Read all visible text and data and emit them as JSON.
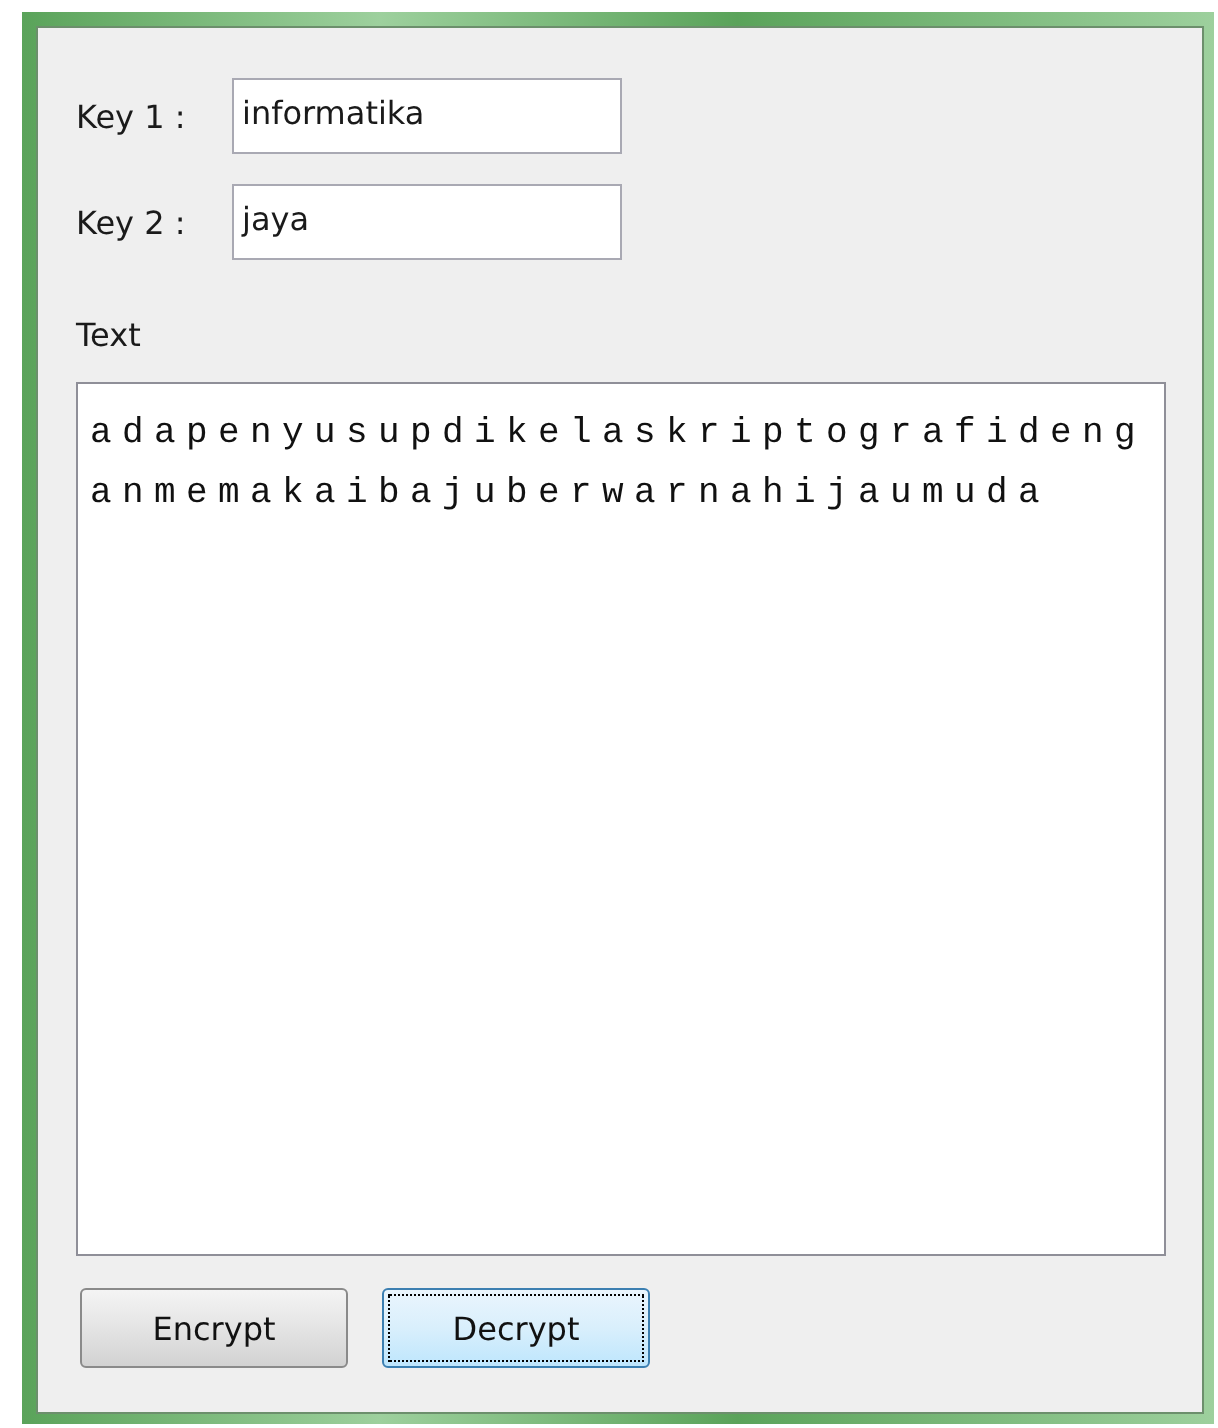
{
  "keys": [
    {
      "label": "Key 1 :",
      "value": "informatika"
    },
    {
      "label": "Key 2 :",
      "value": "jaya"
    }
  ],
  "text": {
    "label": "Text",
    "value": "adapenyusupdikelaskriptografidenganmemakaibajuberwarnahijaumuda"
  },
  "buttons": [
    {
      "label": "Encrypt",
      "focused": false
    },
    {
      "label": "Decrypt",
      "focused": true
    }
  ]
}
